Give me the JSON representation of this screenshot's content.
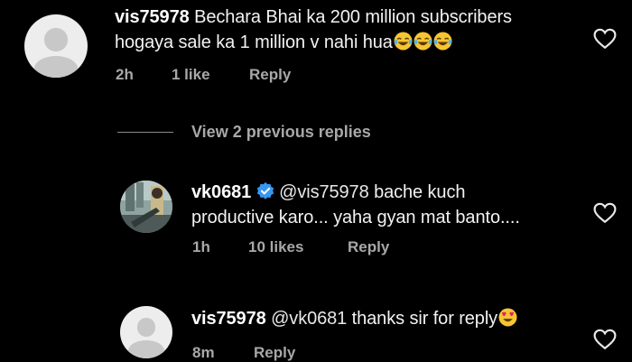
{
  "comment1": {
    "username": "vis75978",
    "text_line1": "Bechara Bhai ka 200 million subscribers",
    "text_line2": "hogaya sale ka 1 million v nahi hua",
    "emojis": [
      "laughing-crying-emoji",
      "laughing-crying-emoji",
      "laughing-crying-emoji"
    ],
    "time": "2h",
    "likes": "1 like",
    "reply_label": "Reply"
  },
  "view_previous": {
    "label": "View 2 previous replies"
  },
  "comment2": {
    "username": "vk0681",
    "verified": true,
    "mention": "@vis75978",
    "text_line1_rest": "bache kuch",
    "text_line2": "productive karo... yaha gyan mat banto....",
    "time": "1h",
    "likes": "10 likes",
    "reply_label": "Reply"
  },
  "comment3": {
    "username": "vis75978",
    "mention": "@vk0681",
    "text_rest": "thanks sir for reply",
    "emoji": "heart-eyes-emoji",
    "time": "8m",
    "reply_label": "Reply"
  },
  "colors": {
    "background": "#000000",
    "text": "#f2f2f2",
    "meta": "#a8a8a8",
    "verified_badge": "#3897f0",
    "emoji_yellow": "#f7c531"
  }
}
